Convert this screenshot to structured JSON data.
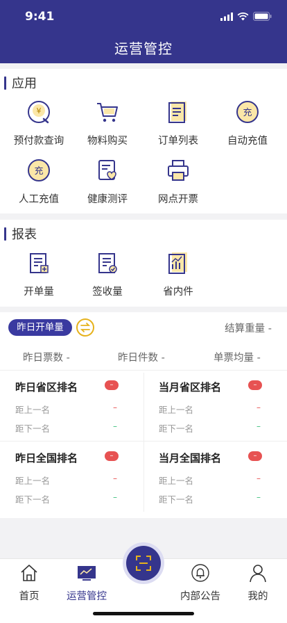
{
  "status": {
    "time": "9:41"
  },
  "header": {
    "title": "运营管控"
  },
  "apps": {
    "title": "应用",
    "items": [
      {
        "label": "预付款查询",
        "icon": "prepay-icon"
      },
      {
        "label": "物料购买",
        "icon": "cart-icon"
      },
      {
        "label": "订单列表",
        "icon": "order-list-icon"
      },
      {
        "label": "自动充值",
        "icon": "auto-recharge-icon"
      },
      {
        "label": "人工充值",
        "icon": "manual-recharge-icon"
      },
      {
        "label": "健康测评",
        "icon": "health-icon"
      },
      {
        "label": "网点开票",
        "icon": "printer-icon"
      }
    ]
  },
  "reports": {
    "title": "报表",
    "items": [
      {
        "label": "开单量",
        "icon": "open-order-icon"
      },
      {
        "label": "签收量",
        "icon": "sign-receipt-icon"
      },
      {
        "label": "省内件",
        "icon": "province-chart-icon"
      }
    ]
  },
  "summary": {
    "tab_label": "昨日开单量",
    "settle_weight": "结算重量 -",
    "stat_tickets": "昨日票数 -",
    "stat_pieces": "昨日件数 -",
    "stat_avg": "单票均量 -"
  },
  "rankings": [
    {
      "title": "昨日省区排名",
      "badge": "–",
      "up_label": "距上一名",
      "up_val": "–",
      "down_label": "距下一名",
      "down_val": "–"
    },
    {
      "title": "当月省区排名",
      "badge": "–",
      "up_label": "距上一名",
      "up_val": "–",
      "down_label": "距下一名",
      "down_val": "–"
    },
    {
      "title": "昨日全国排名",
      "badge": "–",
      "up_label": "距上一名",
      "up_val": "–",
      "down_label": "距下一名",
      "down_val": "–"
    },
    {
      "title": "当月全国排名",
      "badge": "–",
      "up_label": "距上一名",
      "up_val": "–",
      "down_label": "距下一名",
      "down_val": "–"
    }
  ],
  "tabbar": {
    "home": "首页",
    "ops": "运营管控",
    "notice": "内部公告",
    "mine": "我的"
  },
  "colors": {
    "primary": "#35358c",
    "accent": "#e6b21c",
    "badge": "#e75252",
    "positive": "#3cbf7c"
  }
}
